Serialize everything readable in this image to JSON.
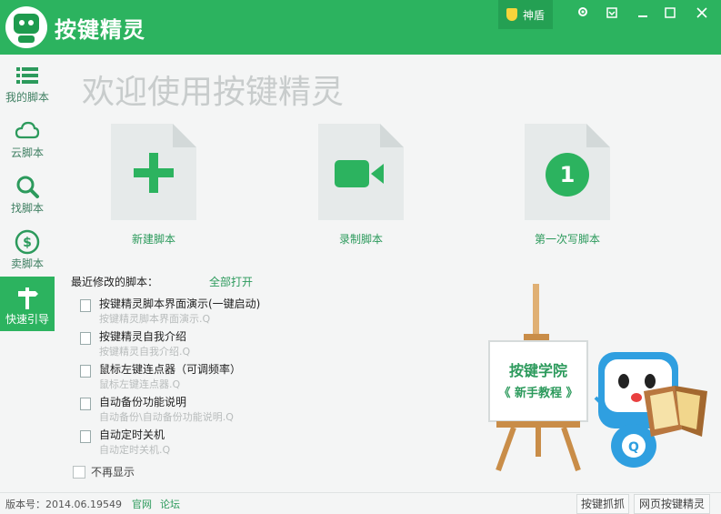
{
  "app": {
    "title": "按键精灵",
    "shield_label": "神盾"
  },
  "sidebar": {
    "items": [
      {
        "label": "我的脚本",
        "icon": "list-icon"
      },
      {
        "label": "云脚本",
        "icon": "cloud-icon"
      },
      {
        "label": "找脚本",
        "icon": "search-icon"
      },
      {
        "label": "卖脚本",
        "icon": "dollar-icon"
      },
      {
        "label": "快速引导",
        "icon": "signpost-icon"
      }
    ],
    "active_index": 4
  },
  "main": {
    "welcome": "欢迎使用按键精灵",
    "cards": [
      {
        "label": "新建脚本",
        "icon": "plus-icon"
      },
      {
        "label": "录制脚本",
        "icon": "video-camera-icon"
      },
      {
        "label": "第一次写脚本",
        "icon": "number-one-icon",
        "number": "1"
      }
    ],
    "recent": {
      "title": "最近修改的脚本：",
      "open_all": "全部打开",
      "items": [
        {
          "name": "按键精灵脚本界面演示(一键启动)",
          "sub": "按键精灵脚本界面演示.Q"
        },
        {
          "name": "按键精灵自我介绍",
          "sub": "按键精灵自我介绍.Q"
        },
        {
          "name": "鼠标左键连点器（可调频率）",
          "sub": "鼠标左键连点器.Q"
        },
        {
          "name": "自动备份功能说明",
          "sub": "自动备份\\自动备份功能说明.Q"
        },
        {
          "name": "自动定时关机",
          "sub": "自动定时关机.Q"
        }
      ]
    },
    "no_show": "不再显示",
    "mascot": {
      "board_line1": "按键学院",
      "board_line2": "《 新手教程 》",
      "badge": "Q"
    }
  },
  "status": {
    "version": "版本号：2014.06.19549",
    "link_official": "官网",
    "link_forum": "论坛",
    "btn_capture": "按键抓抓",
    "btn_web": "网页按键精灵"
  },
  "colors": {
    "brand": "#2cb35f",
    "accent_text": "#2c9a5c"
  }
}
